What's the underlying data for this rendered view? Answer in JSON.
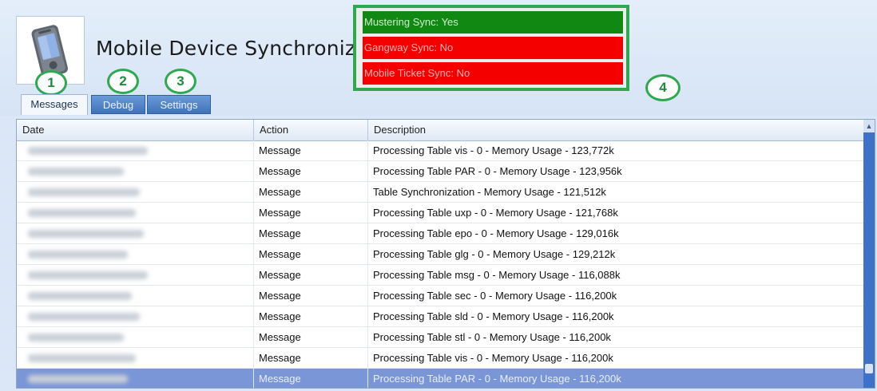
{
  "app": {
    "title": "Mobile Device Synchronize",
    "icon": "pda-device-icon"
  },
  "sync_status": [
    {
      "label": "Mustering Sync: Yes",
      "state": "ok",
      "color": "#118811"
    },
    {
      "label": "Gangway Sync: No",
      "state": "bad",
      "color": "#f50000"
    },
    {
      "label": "Mobile Ticket Sync: No",
      "state": "bad",
      "color": "#f50000"
    }
  ],
  "callouts": [
    "1",
    "2",
    "3",
    "4"
  ],
  "tabs": [
    {
      "label": "Messages",
      "active": true
    },
    {
      "label": "Debug",
      "active": false
    },
    {
      "label": "Settings",
      "active": false
    }
  ],
  "grid": {
    "columns": [
      "Date",
      "Action",
      "Description"
    ],
    "rows": [
      {
        "action": "Message",
        "description": "Processing Table vis - 0 - Memory Usage - 123,772k"
      },
      {
        "action": "Message",
        "description": "Processing Table PAR - 0 - Memory Usage - 123,956k"
      },
      {
        "action": "Message",
        "description": "Table Synchronization - Memory Usage - 121,512k"
      },
      {
        "action": "Message",
        "description": "Processing Table uxp - 0 - Memory Usage - 121,768k"
      },
      {
        "action": "Message",
        "description": "Processing Table epo - 0 - Memory Usage - 129,016k"
      },
      {
        "action": "Message",
        "description": "Processing Table glg - 0 - Memory Usage - 129,212k"
      },
      {
        "action": "Message",
        "description": "Processing Table msg - 0 - Memory Usage - 116,088k"
      },
      {
        "action": "Message",
        "description": "Processing Table sec - 0 - Memory Usage - 116,200k"
      },
      {
        "action": "Message",
        "description": "Processing Table sld - 0 - Memory Usage - 116,200k"
      },
      {
        "action": "Message",
        "description": "Processing Table stl - 0 - Memory Usage - 116,200k"
      },
      {
        "action": "Message",
        "description": "Processing Table vis - 0 - Memory Usage - 116,200k"
      },
      {
        "action": "Message",
        "description": "Processing Table PAR - 0 - Memory Usage - 116,200k",
        "selected": true
      }
    ]
  }
}
